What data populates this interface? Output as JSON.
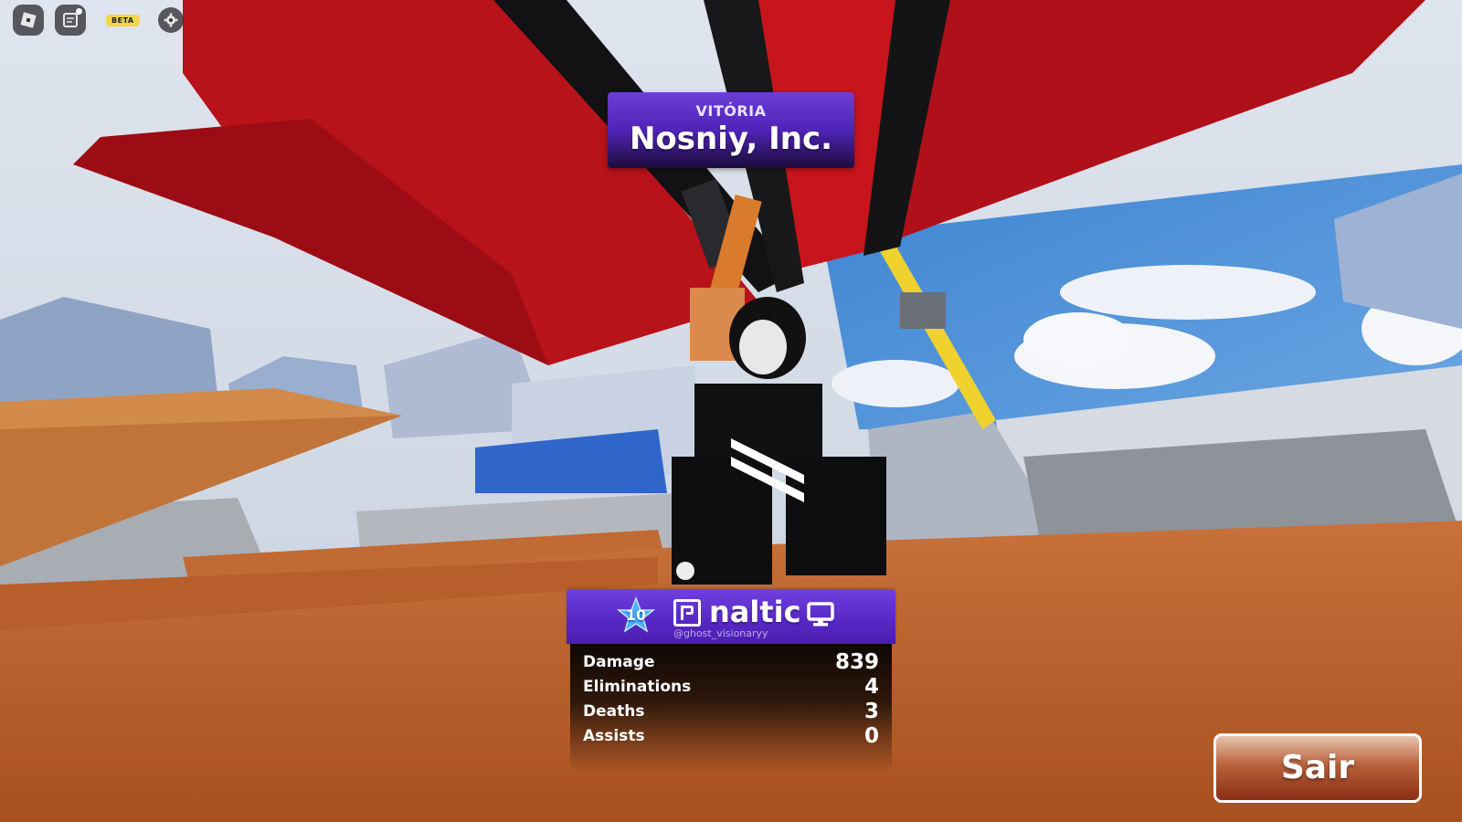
{
  "topbar": {
    "roblox_icon": "roblox-logo-icon",
    "chat_icon": "chat-icon",
    "beta_label": "BETA",
    "settings_icon": "gear-icon"
  },
  "victory": {
    "subtitle": "VITÓRIA",
    "team_name": "Nosniy, Inc."
  },
  "player": {
    "level": "10",
    "name": "naltic",
    "handle": "@ghost_visionaryy",
    "platform_icon": "monitor-icon",
    "clan_icon": "clan-icon"
  },
  "stats": [
    {
      "label": "Damage",
      "value": "839"
    },
    {
      "label": "Eliminations",
      "value": "4"
    },
    {
      "label": "Deaths",
      "value": "3"
    },
    {
      "label": "Assists",
      "value": "0"
    }
  ],
  "exit_button": {
    "label": "Sair"
  },
  "colors": {
    "banner_purple": "#5a2ac8",
    "container_red": "#b8121a",
    "floor_orange": "#c2662c",
    "sky": "#5a9ad9"
  }
}
